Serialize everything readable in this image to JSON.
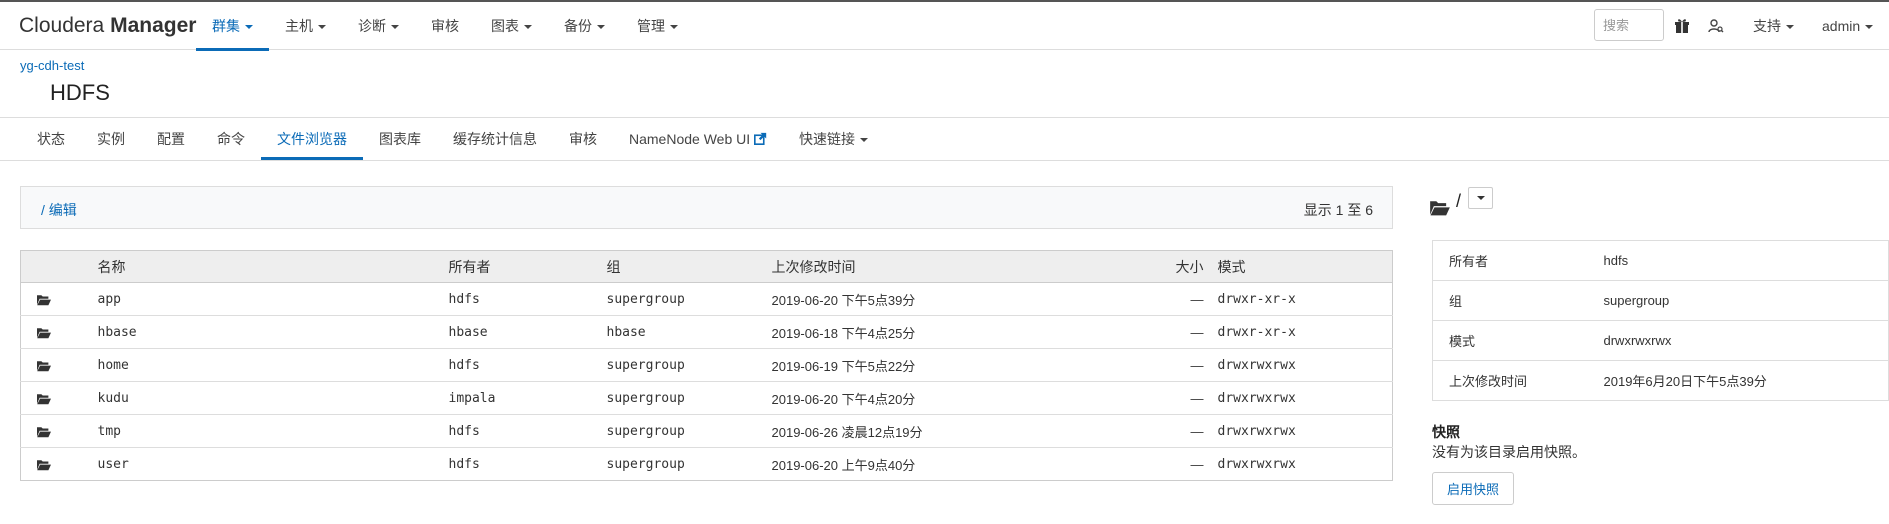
{
  "brand": {
    "prefix": "Cloudera",
    "name": "Manager"
  },
  "nav": {
    "items": [
      {
        "label": "群集",
        "active": true,
        "dropdown": true
      },
      {
        "label": "主机",
        "active": false,
        "dropdown": true
      },
      {
        "label": "诊断",
        "active": false,
        "dropdown": true
      },
      {
        "label": "审核",
        "active": false,
        "dropdown": false
      },
      {
        "label": "图表",
        "active": false,
        "dropdown": true
      },
      {
        "label": "备份",
        "active": false,
        "dropdown": true
      },
      {
        "label": "管理",
        "active": false,
        "dropdown": true
      }
    ],
    "search_placeholder": "搜索",
    "support_label": "支持",
    "user_label": "admin"
  },
  "header": {
    "cluster": "yg-cdh-test",
    "service": "HDFS"
  },
  "tabs": [
    {
      "label": "状态",
      "active": false
    },
    {
      "label": "实例",
      "active": false
    },
    {
      "label": "配置",
      "active": false
    },
    {
      "label": "命令",
      "active": false
    },
    {
      "label": "文件浏览器",
      "active": true
    },
    {
      "label": "图表库",
      "active": false
    },
    {
      "label": "缓存统计信息",
      "active": false
    },
    {
      "label": "审核",
      "active": false
    },
    {
      "label": "NameNode Web UI",
      "active": false
    },
    {
      "label": "快速链接",
      "active": false
    }
  ],
  "pathbar": {
    "path": "/",
    "edit_label": "编辑",
    "count_text": "显示 1 至 6"
  },
  "table": {
    "columns": {
      "name": "名称",
      "owner": "所有者",
      "group": "组",
      "modified": "上次修改时间",
      "size": "大小",
      "mode": "模式"
    },
    "rows": [
      {
        "name": "app",
        "owner": "hdfs",
        "group": "supergroup",
        "modified": "2019-06-20 下午5点39分",
        "size": "—",
        "mode": "drwxr-xr-x"
      },
      {
        "name": "hbase",
        "owner": "hbase",
        "group": "hbase",
        "modified": "2019-06-18 下午4点25分",
        "size": "—",
        "mode": "drwxr-xr-x"
      },
      {
        "name": "home",
        "owner": "hdfs",
        "group": "supergroup",
        "modified": "2019-06-19 下午5点22分",
        "size": "—",
        "mode": "drwxrwxrwx"
      },
      {
        "name": "kudu",
        "owner": "impala",
        "group": "supergroup",
        "modified": "2019-06-20 下午4点20分",
        "size": "—",
        "mode": "drwxrwxrwx"
      },
      {
        "name": "tmp",
        "owner": "hdfs",
        "group": "supergroup",
        "modified": "2019-06-26 凌晨12点19分",
        "size": "—",
        "mode": "drwxrwxrwx"
      },
      {
        "name": "user",
        "owner": "hdfs",
        "group": "supergroup",
        "modified": "2019-06-20 上午9点40分",
        "size": "—",
        "mode": "drwxrwxrwx"
      }
    ]
  },
  "details": {
    "path": "/",
    "props": [
      {
        "key": "所有者",
        "value": "hdfs"
      },
      {
        "key": "组",
        "value": "supergroup"
      },
      {
        "key": "模式",
        "value": "drwxrwxrwx"
      },
      {
        "key": "上次修改时间",
        "value": "2019年6月20日下午5点39分"
      }
    ],
    "snapshot_title": "快照",
    "snapshot_text": "没有为该目录启用快照。",
    "snapshot_button": "启用快照"
  },
  "colors": {
    "accent": "#0b6bb7",
    "header_bg": "#eeeeee",
    "pathbar_bg": "#f8f9fa"
  },
  "icons": [
    "folder-open-icon",
    "gift-icon",
    "user-search-icon",
    "external-link-icon",
    "caret-down-icon"
  ]
}
